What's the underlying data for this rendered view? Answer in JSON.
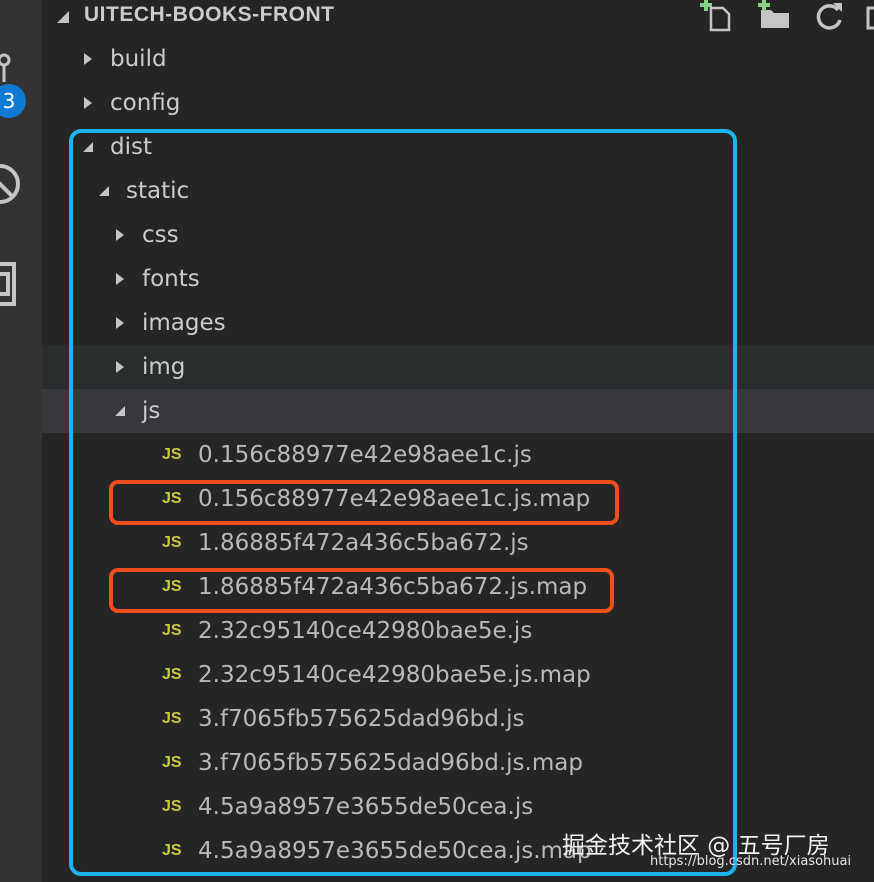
{
  "explorer": {
    "title": "UITECH-BOOKS-FRONT",
    "badge_count": "3"
  },
  "tree": [
    {
      "type": "folder",
      "label": "build",
      "depth": 0,
      "expanded": false
    },
    {
      "type": "folder",
      "label": "config",
      "depth": 0,
      "expanded": false
    },
    {
      "type": "folder",
      "label": "dist",
      "depth": 0,
      "expanded": true
    },
    {
      "type": "folder",
      "label": "static",
      "depth": 1,
      "expanded": true
    },
    {
      "type": "folder",
      "label": "css",
      "depth": 2,
      "expanded": false
    },
    {
      "type": "folder",
      "label": "fonts",
      "depth": 2,
      "expanded": false
    },
    {
      "type": "folder",
      "label": "images",
      "depth": 2,
      "expanded": false
    },
    {
      "type": "folder",
      "label": "img",
      "depth": 2,
      "expanded": false,
      "state": "hover"
    },
    {
      "type": "folder",
      "label": "js",
      "depth": 2,
      "expanded": true,
      "state": "selected"
    },
    {
      "type": "file",
      "icon": "JS",
      "label": "0.156c88977e42e98aee1c.js",
      "depth": 3
    },
    {
      "type": "file",
      "icon": "JS",
      "label": "0.156c88977e42e98aee1c.js.map",
      "depth": 3,
      "highlight": true
    },
    {
      "type": "file",
      "icon": "JS",
      "label": "1.86885f472a436c5ba672.js",
      "depth": 3
    },
    {
      "type": "file",
      "icon": "JS",
      "label": "1.86885f472a436c5ba672.js.map",
      "depth": 3,
      "highlight": true
    },
    {
      "type": "file",
      "icon": "JS",
      "label": "2.32c95140ce42980bae5e.js",
      "depth": 3
    },
    {
      "type": "file",
      "icon": "JS",
      "label": "2.32c95140ce42980bae5e.js.map",
      "depth": 3
    },
    {
      "type": "file",
      "icon": "JS",
      "label": "3.f7065fb575625dad96bd.js",
      "depth": 3
    },
    {
      "type": "file",
      "icon": "JS",
      "label": "3.f7065fb575625dad96bd.js.map",
      "depth": 3
    },
    {
      "type": "file",
      "icon": "JS",
      "label": "4.5a9a8957e3655de50cea.js",
      "depth": 3
    },
    {
      "type": "file",
      "icon": "JS",
      "label": "4.5a9a8957e3655de50cea.js.map",
      "depth": 3
    }
  ],
  "watermark": {
    "text": "掘金技术社区 @ 五号厂房",
    "url": "https://blog.csdn.net/xiasohuai"
  },
  "colors": {
    "background": "#252526",
    "activity_bar": "#333333",
    "text": "#cccccc",
    "js_icon": "#cbcb41",
    "annotation_blue": "#1fb3ee",
    "annotation_red": "#ee4f1c",
    "badge": "#0e7ad3"
  }
}
